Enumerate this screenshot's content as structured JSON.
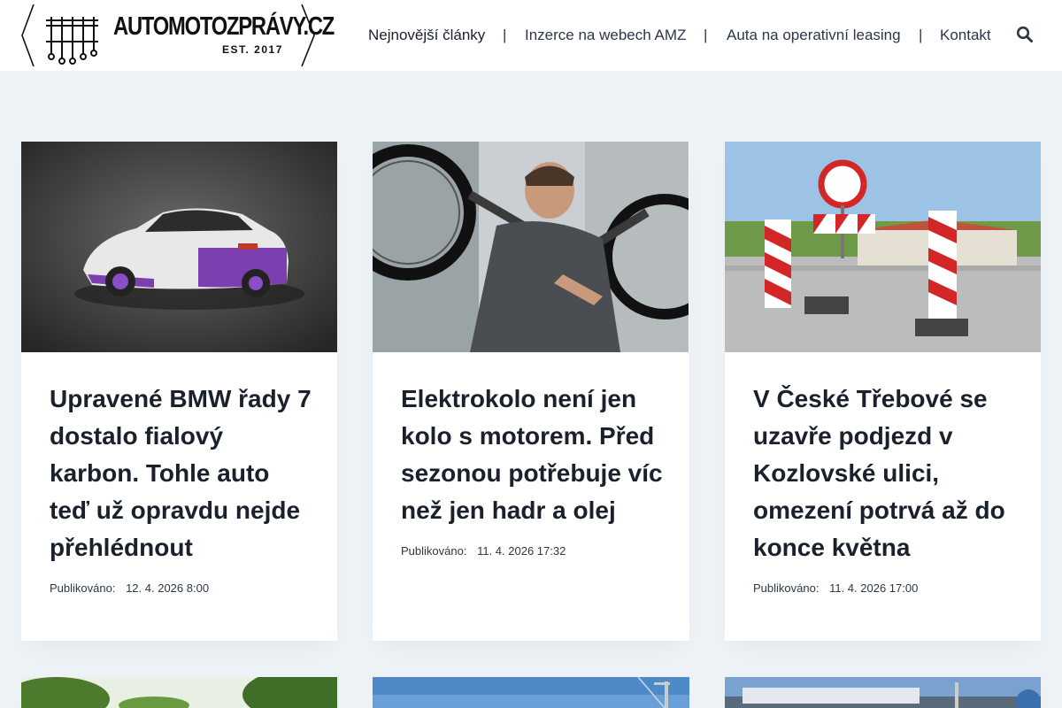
{
  "header": {
    "logo": {
      "name": "AUTOMOTOZPRÁVY.CZ",
      "est": "EST. 2017"
    },
    "nav": [
      {
        "label": "Nejnovější články"
      },
      {
        "label": "Inzerce na webech AMZ"
      },
      {
        "label": "Auta na operativní leasing"
      },
      {
        "label": "Kontakt"
      }
    ],
    "separator": "|",
    "search_icon": "search-icon"
  },
  "articles": [
    {
      "title": "Upravené BMW řady 7 dostalo fialový karbon. Tohle auto teď už opravdu nejde přehlédnout",
      "published_label": "Publikováno:",
      "published": "12. 4. 2026 8:00"
    },
    {
      "title": "Elektrokolo není jen kolo s motorem. Před sezonou potřebuje víc než jen hadr a olej",
      "published_label": "Publikováno:",
      "published": "11. 4. 2026 17:32"
    },
    {
      "title": "V České Třebové se uzavře podjezd v Kozlovské ulici, omezení potrvá až do konce května",
      "published_label": "Publikováno:",
      "published": "11. 4. 2026 17:00"
    }
  ],
  "colors": {
    "background": "#edf2f7",
    "card": "#ffffff",
    "text": "#1a202c"
  }
}
